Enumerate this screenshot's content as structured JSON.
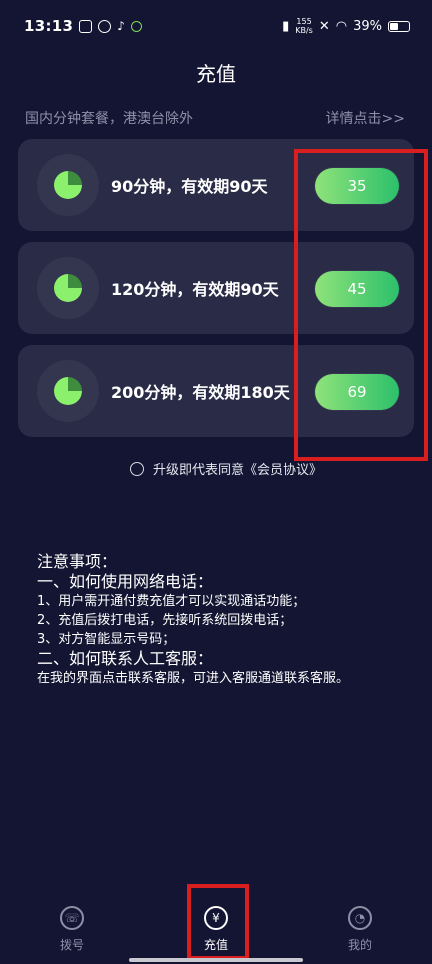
{
  "status": {
    "time": "13:13",
    "speed_top": "155",
    "speed_bottom": "KB/s",
    "battery": "39%"
  },
  "header": {
    "title": "充值"
  },
  "subheader": {
    "left": "国内分钟套餐，港澳台除外",
    "right": "详情点击>>"
  },
  "plans": [
    {
      "title": "90分钟，有效期90天",
      "price": "35"
    },
    {
      "title": "120分钟，有效期90天",
      "price": "45"
    },
    {
      "title": "200分钟，有效期180天",
      "price": "69"
    }
  ],
  "agreement": {
    "text": "升级即代表同意《会员协议》"
  },
  "notes": {
    "heading": "注意事项：",
    "section1": "一、如何使用网络电话：",
    "item1": "1、用户需开通付费充值才可以实现通话功能；",
    "item2": "2、充值后拨打电话，先接听系统回拨电话；",
    "item3": "3、对方智能显示号码；",
    "section2": "二、如何联系人工客服：",
    "item4": "在我的界面点击联系客服，可进入客服通道联系客服。"
  },
  "tabs": [
    {
      "label": "拨号",
      "icon": "phone-icon"
    },
    {
      "label": "充值",
      "icon": "yuan-icon"
    },
    {
      "label": "我的",
      "icon": "user-icon"
    }
  ],
  "colors": {
    "background": "#141533",
    "card": "#2a2b46",
    "accent_green": "#2cc06b",
    "highlight_red": "#d81e1e"
  }
}
